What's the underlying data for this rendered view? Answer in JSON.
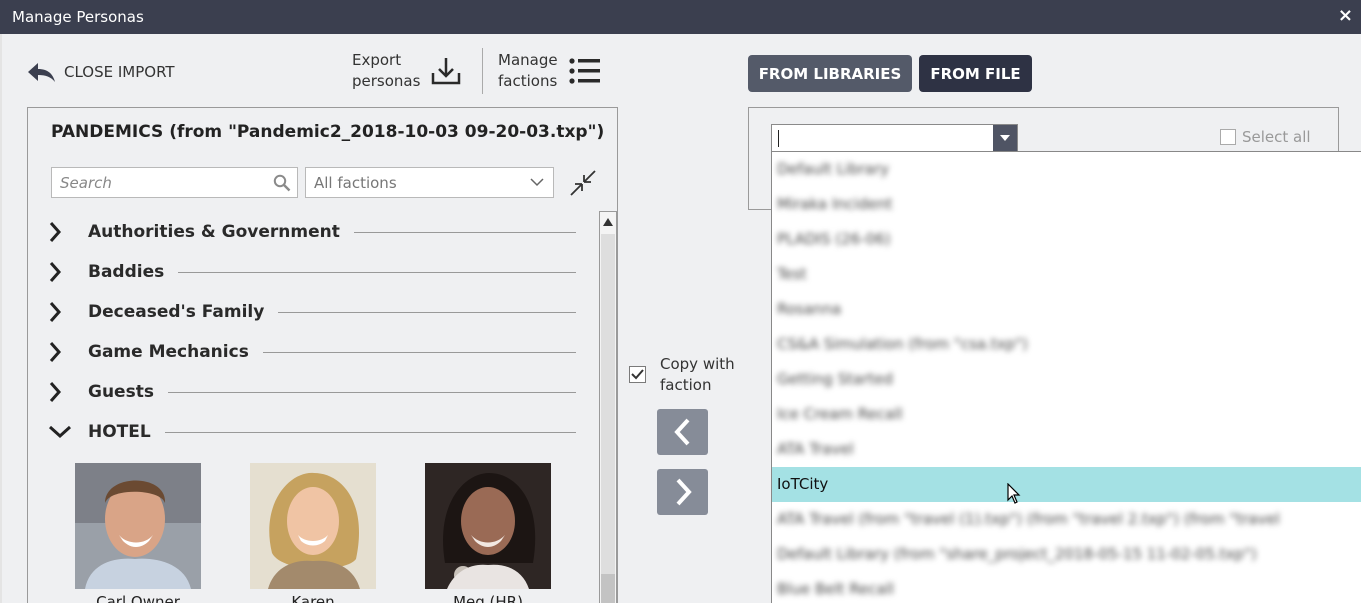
{
  "window": {
    "title": "Manage Personas",
    "close_label": "×"
  },
  "toolbar": {
    "close_import": "CLOSE IMPORT",
    "export_line1": "Export",
    "export_line2": "personas",
    "manage_line1": "Manage",
    "manage_line2": "factions"
  },
  "left_panel": {
    "title": "PANDEMICS (from \"Pandemic2_2018-10-03 09-20-03.txp\")",
    "search_placeholder": "Search",
    "factions_filter": "All factions",
    "groups": [
      {
        "name": "Authorities & Government",
        "expanded": false
      },
      {
        "name": "Baddies",
        "expanded": false
      },
      {
        "name": "Deceased's Family",
        "expanded": false
      },
      {
        "name": "Game Mechanics",
        "expanded": false
      },
      {
        "name": "Guests",
        "expanded": false
      },
      {
        "name": "HOTEL",
        "expanded": true
      }
    ],
    "personas": [
      {
        "name": "Carl Owner"
      },
      {
        "name": "Karen"
      },
      {
        "name": "Meg (HR)"
      }
    ]
  },
  "middle": {
    "copy_with_faction_line1": "Copy with",
    "copy_with_faction_line2": "faction",
    "copy_with_faction_checked": true
  },
  "right_panel": {
    "from_libraries": "FROM LIBRARIES",
    "from_file": "FROM FILE",
    "combo_value": "",
    "select_all": "Select all",
    "dropdown_items": [
      {
        "label": "Default Library",
        "selected": false
      },
      {
        "label": "Miraka Incident",
        "selected": false
      },
      {
        "label": "PLADIS (26-06)",
        "selected": false
      },
      {
        "label": "Test",
        "selected": false
      },
      {
        "label": "Rosanna",
        "selected": false
      },
      {
        "label": "CS&A Simulation (from \"csa.txp\")",
        "selected": false
      },
      {
        "label": "Getting Started",
        "selected": false
      },
      {
        "label": "Ice Cream Recall",
        "selected": false
      },
      {
        "label": "ATA Travel",
        "selected": false
      },
      {
        "label": "IoTCity",
        "selected": true
      },
      {
        "label": "ATA Travel (from \"travel (1).txp\") (from \"travel 2.txp\") (from \"travel",
        "selected": false
      },
      {
        "label": "Default Library (from \"share_project_2018-05-15 11-02-05.txp\")",
        "selected": false
      },
      {
        "label": "Blue Belt Recall",
        "selected": false
      }
    ]
  },
  "colors": {
    "titlebar": "#3b3f4f",
    "selected_row": "#a4e1e4",
    "button_dark": "#2e3244",
    "button_medium": "#545a69",
    "move_button": "#868c98"
  }
}
